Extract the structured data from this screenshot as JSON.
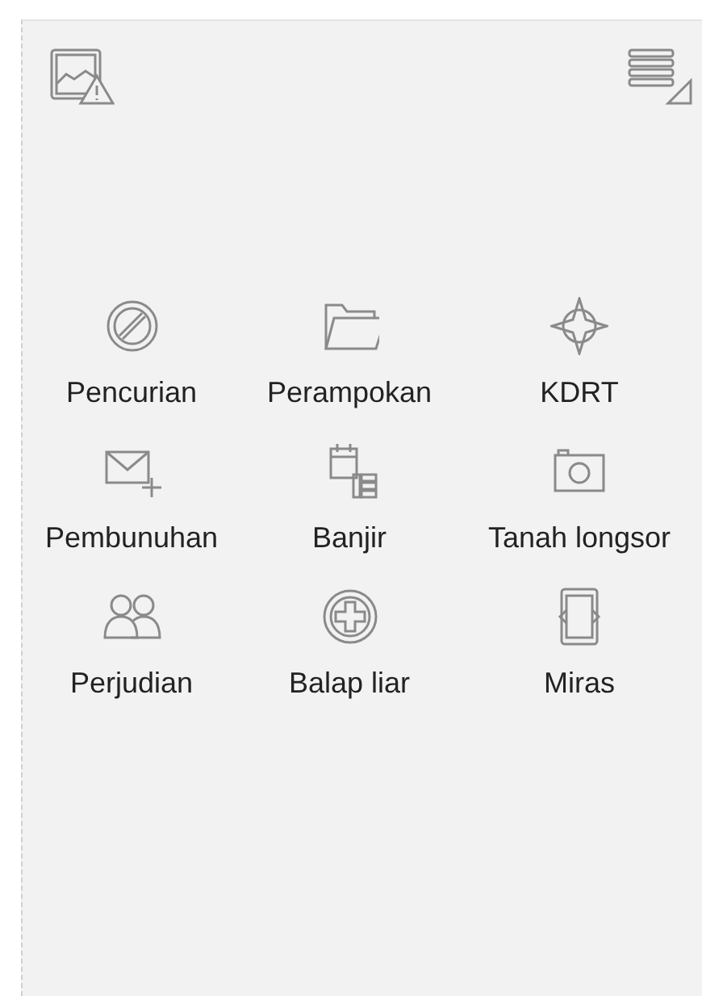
{
  "items": [
    {
      "label": "Pencurian"
    },
    {
      "label": "Perampokan"
    },
    {
      "label": "KDRT"
    },
    {
      "label": "Pembunuhan"
    },
    {
      "label": "Banjir"
    },
    {
      "label": "Tanah longsor"
    },
    {
      "label": "Perjudian"
    },
    {
      "label": "Balap liar"
    },
    {
      "label": "Miras"
    }
  ]
}
